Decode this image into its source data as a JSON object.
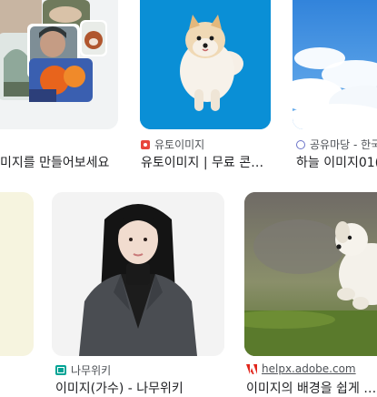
{
  "results": [
    {
      "id": "collage",
      "source": "",
      "caption": "미지를 만들어보세요",
      "colors": {
        "bg": "#f1f3f4"
      }
    },
    {
      "id": "pomeranian",
      "source": "유토이미지",
      "caption": "유토이미지 | 무료 콘…",
      "favicon_icon": "utoimage-icon",
      "colors": {
        "bg": "#0a8fd6",
        "favicon": "#e8453c"
      }
    },
    {
      "id": "sky",
      "source": "공유마당 - 한국",
      "caption": "하늘 이미지01(",
      "favicon_icon": "gongu-icon",
      "colors": {
        "bg": "#3a8fe0",
        "favicon": "#6a73c8"
      }
    },
    {
      "id": "yellow",
      "source": "",
      "caption": "",
      "colors": {
        "bg": "#f6f4df"
      }
    },
    {
      "id": "woman",
      "source": "나무위키",
      "caption": "이미지(가수) - 나무위키",
      "favicon_icon": "namuwiki-icon",
      "colors": {
        "bg": "#f3f3f3",
        "favicon": "#00a495"
      }
    },
    {
      "id": "dog",
      "source": "helpx.adobe.com",
      "caption": "이미지의 배경을 쉽게 …",
      "favicon_icon": "adobe-icon",
      "colors": {
        "bg": "#6b7458",
        "favicon": "#e1251b"
      }
    }
  ]
}
